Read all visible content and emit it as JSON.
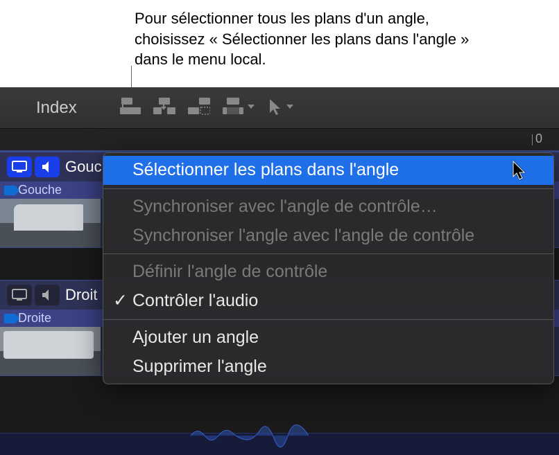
{
  "instruction": "Pour sélectionner tous les plans d'un angle, choisissez « Sélectionner les plans dans l'angle » dans le menu local.",
  "toolbar": {
    "index_label": "Index"
  },
  "ruler": {
    "value": "0"
  },
  "tracks": [
    {
      "title": "Gouc",
      "clip_label": "Gouche"
    },
    {
      "title": "Droit",
      "clip_label": "Droite"
    }
  ],
  "menu": {
    "select_clips": "Sélectionner les plans dans l'angle",
    "sync_control": "Synchroniser avec l'angle de contrôle…",
    "sync_angle_control": "Synchroniser l'angle avec l'angle de contrôle",
    "set_control": "Définir l'angle de contrôle",
    "monitor_audio": "Contrôler l'audio",
    "monitor_audio_check": "✓",
    "add_angle": "Ajouter un angle",
    "delete_angle": "Supprimer l'angle"
  }
}
